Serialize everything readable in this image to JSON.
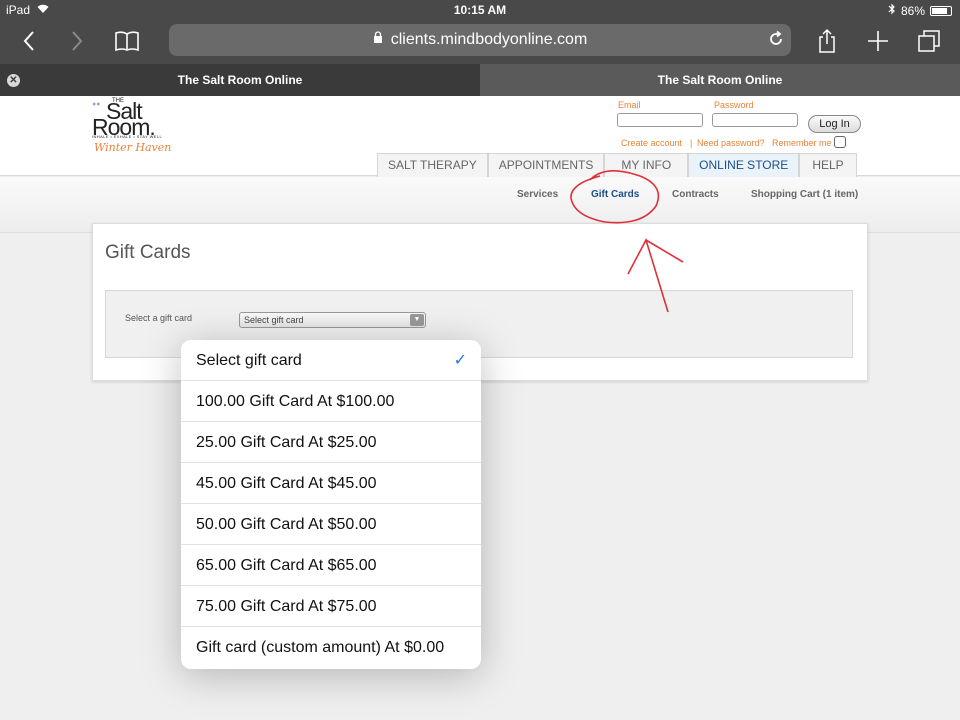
{
  "status_bar": {
    "device": "iPad",
    "time": "10:15 AM",
    "battery": "86%",
    "battery_level": 0.86
  },
  "browser": {
    "url": "clients.mindbodyonline.com",
    "tabs": [
      {
        "title": "The Salt Room Online"
      },
      {
        "title": "The Salt Room Online"
      }
    ]
  },
  "logo": {
    "the": "THE",
    "line1": "Salt",
    "line2": "Room.",
    "tagline": "INHALE • EXHALE • STAY WELL",
    "city": "Winter Haven"
  },
  "login": {
    "email_label": "Email",
    "password_label": "Password",
    "button": "Log In",
    "create_account": "Create account",
    "separator": "|",
    "need_password": "Need password?",
    "remember_me": "Remember me"
  },
  "nav": {
    "tabs": [
      {
        "label": "SALT THERAPY"
      },
      {
        "label": "APPOINTMENTS"
      },
      {
        "label": "MY INFO"
      },
      {
        "label": "ONLINE STORE"
      },
      {
        "label": "HELP"
      }
    ],
    "active_index": 3
  },
  "subnav": {
    "items": [
      {
        "label": "Services"
      },
      {
        "label": "Gift Cards"
      },
      {
        "label": "Contracts"
      },
      {
        "label": "Shopping Cart (1 item)"
      }
    ],
    "active_index": 1
  },
  "panel": {
    "title": "Gift Cards",
    "select_label": "Select a gift card",
    "select_value": "Select gift card"
  },
  "dropdown": {
    "options": [
      {
        "label": "Select gift card",
        "selected": true
      },
      {
        "label": "100.00 Gift Card At  $100.00"
      },
      {
        "label": "25.00 Gift Card At  $25.00"
      },
      {
        "label": "45.00 Gift Card At  $45.00"
      },
      {
        "label": "50.00 Gift Card At  $50.00"
      },
      {
        "label": "65.00 Gift Card At  $65.00"
      },
      {
        "label": "75.00 Gift Card At  $75.00"
      },
      {
        "label": "Gift card (custom amount) At  $0.00"
      }
    ]
  },
  "colors": {
    "accent": "#1c4f8c",
    "orange": "#e8833a",
    "annotation": "#e0303a",
    "check": "#1e7ae6"
  }
}
